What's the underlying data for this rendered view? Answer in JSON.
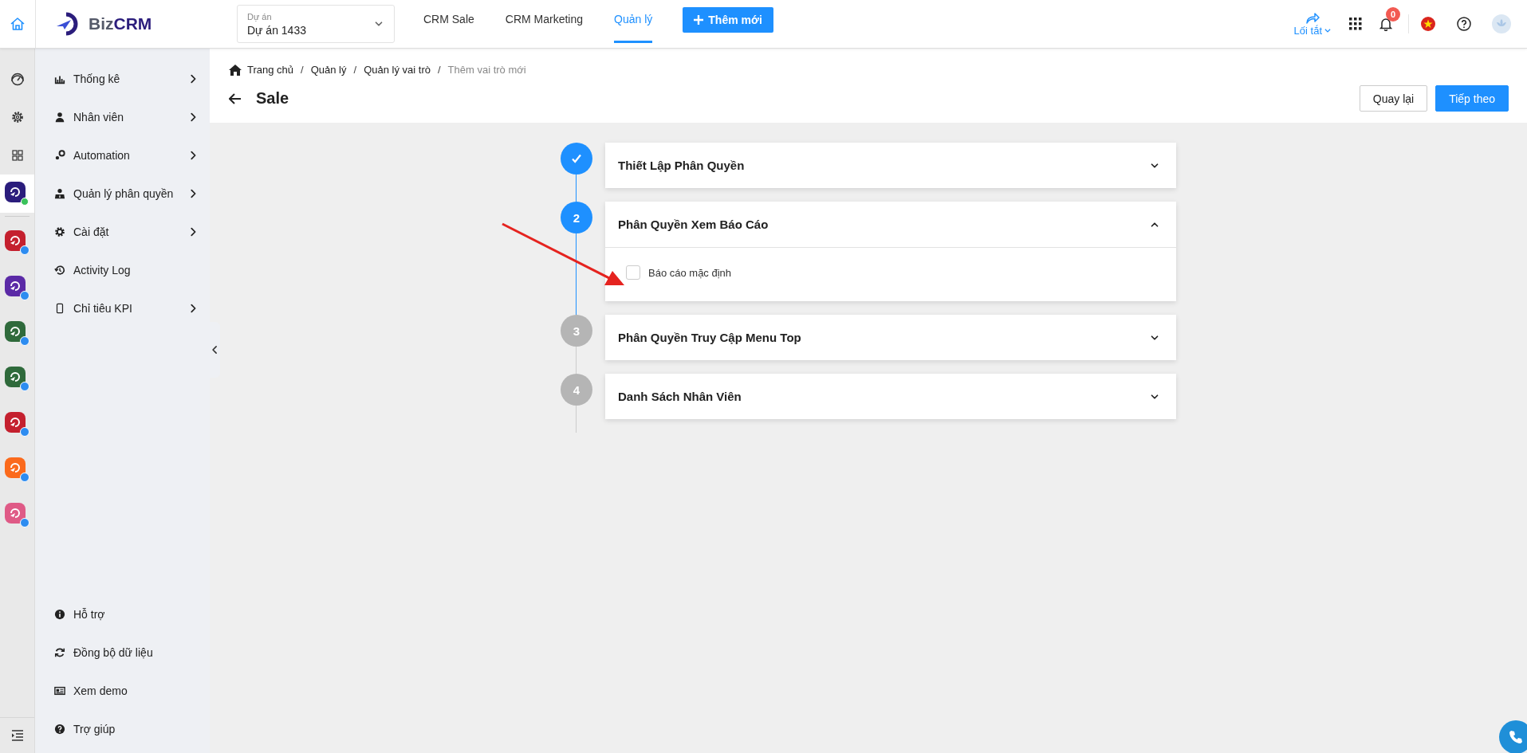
{
  "top_bar": {
    "logo": {
      "part1": "Biz",
      "part2": "CRM"
    },
    "project": {
      "label": "Dự án",
      "value": "Dự án 1433"
    },
    "tabs": [
      {
        "label": "CRM Sale",
        "selected": false
      },
      {
        "label": "CRM Marketing",
        "selected": false
      },
      {
        "label": "Quản lý",
        "selected": true
      }
    ],
    "add_button": "Thêm mới",
    "shortcut": "Lối tắt",
    "notification_count": "0"
  },
  "rail": {
    "items": [
      {
        "kind": "tool",
        "selected": false
      },
      {
        "kind": "tool",
        "selected": false
      },
      {
        "kind": "tool",
        "selected": false
      },
      {
        "kind": "app",
        "selected": true,
        "color": "#2b1d7c"
      },
      {
        "kind": "app",
        "selected": false,
        "color": "#c4202e"
      },
      {
        "kind": "app",
        "selected": false,
        "color": "#5b2aa6"
      },
      {
        "kind": "app",
        "selected": false,
        "color": "#2f6a3b"
      },
      {
        "kind": "app",
        "selected": false,
        "color": "#2f6a3b"
      },
      {
        "kind": "app",
        "selected": false,
        "color": "#c4202e"
      },
      {
        "kind": "app",
        "selected": false,
        "color": "#fb6a1c"
      },
      {
        "kind": "app",
        "selected": false,
        "color": "#df5a86"
      }
    ]
  },
  "sidebar": {
    "items": [
      {
        "label": "Thống kê",
        "has_submenu": true
      },
      {
        "label": "Nhân viên",
        "has_submenu": true
      },
      {
        "label": "Automation",
        "has_submenu": true
      },
      {
        "label": "Quản lý phân quyền",
        "has_submenu": true
      },
      {
        "label": "Cài đặt",
        "has_submenu": true
      },
      {
        "label": "Activity Log",
        "has_submenu": false
      },
      {
        "label": "Chỉ tiêu KPI",
        "has_submenu": true
      }
    ],
    "footer_items": [
      {
        "label": "Hỗ trợ"
      },
      {
        "label": "Đồng bộ dữ liệu"
      },
      {
        "label": "Xem demo"
      },
      {
        "label": "Trợ giúp"
      }
    ]
  },
  "breadcrumb": {
    "separator": "/",
    "items": [
      {
        "label": "Trang chủ",
        "current": false
      },
      {
        "label": "Quản lý",
        "current": false
      },
      {
        "label": "Quản lý vai trò",
        "current": false
      },
      {
        "label": "Thêm vai trò mới",
        "current": true
      }
    ]
  },
  "page_title": "Sale",
  "buttons": {
    "back": "Quay lại",
    "next": "Tiếp theo"
  },
  "steps": [
    {
      "completed": true,
      "reached": true,
      "title": "Thiết Lập Phân Quyền",
      "expanded": false
    },
    {
      "number": "2",
      "completed": false,
      "reached": true,
      "title": "Phân Quyền Xem Báo Cáo",
      "expanded": true,
      "options": [
        {
          "label": "Báo cáo mặc định",
          "checked": false
        }
      ]
    },
    {
      "number": "3",
      "completed": false,
      "reached": false,
      "title": "Phân Quyền Truy Cập Menu Top",
      "expanded": false
    },
    {
      "number": "4",
      "completed": false,
      "reached": false,
      "title": "Danh Sách Nhân Viên",
      "expanded": false
    }
  ]
}
